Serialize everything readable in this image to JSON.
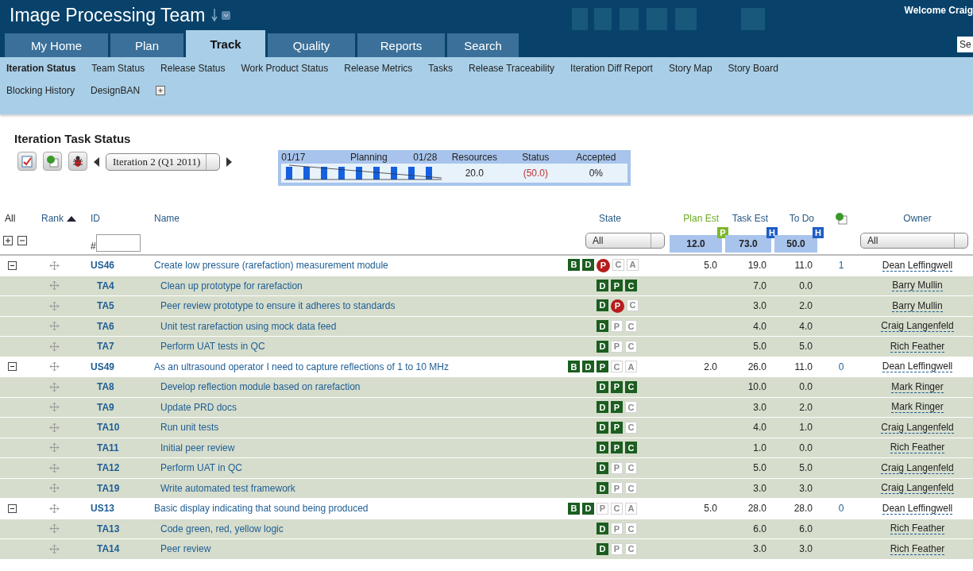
{
  "header": {
    "title": "Image Processing Team",
    "welcome": "Welcome Craig",
    "search": {
      "placeholder": "Se"
    }
  },
  "tabs": [
    {
      "label": "My Home",
      "selected": false
    },
    {
      "label": "Plan",
      "selected": false
    },
    {
      "label": "Track",
      "selected": true
    },
    {
      "label": "Quality",
      "selected": false
    },
    {
      "label": "Reports",
      "selected": false
    },
    {
      "label": "Search",
      "selected": false
    }
  ],
  "subnav": [
    {
      "label": "Iteration Status",
      "selected": true
    },
    {
      "label": "Team Status",
      "selected": false
    },
    {
      "label": "Release Status",
      "selected": false
    },
    {
      "label": "Work Product Status",
      "selected": false
    },
    {
      "label": "Release Metrics",
      "selected": false
    },
    {
      "label": "Tasks",
      "selected": false
    },
    {
      "label": "Release Traceability",
      "selected": false
    },
    {
      "label": "Iteration Diff Report",
      "selected": false
    },
    {
      "label": "Story Map",
      "selected": false
    },
    {
      "label": "Story Board",
      "selected": false
    },
    {
      "label": "Blocking History",
      "selected": false
    },
    {
      "label": "DesignBAN",
      "selected": false
    }
  ],
  "page_title": "Iteration Task Status",
  "iteration_select": "Iteration 2 (Q1 2011)",
  "summary": {
    "start": "01/17",
    "phase": "Planning",
    "end": "01/28",
    "resources_label": "Resources",
    "status_label": "Status",
    "accepted_label": "Accepted",
    "resources": "20.0",
    "status": "(50.0)",
    "accepted": "0%"
  },
  "columns": {
    "all": "All",
    "rank": "Rank",
    "id": "ID",
    "name": "Name",
    "state": "State",
    "plan_est": "Plan Est",
    "task_est": "Task Est",
    "todo": "To Do",
    "owner": "Owner"
  },
  "filters": {
    "id_prefix": "#",
    "state": "All",
    "plan_total": "12.0",
    "plan_badge": "P",
    "task_total": "73.0",
    "task_badge": "H",
    "todo_total": "50.0",
    "todo_badge": "H",
    "owner": "All"
  },
  "rows": [
    {
      "kind": "story",
      "expanded": true,
      "id": "US46",
      "name": "Create low pressure (rarefaction) measurement module",
      "states": [
        {
          "letter": "B",
          "done": true,
          "blocked": false
        },
        {
          "letter": "D",
          "done": true,
          "blocked": false
        },
        {
          "letter": "P",
          "done": false,
          "blocked": true
        },
        {
          "letter": "C",
          "done": false,
          "blocked": false
        },
        {
          "letter": "A",
          "done": false,
          "blocked": false
        }
      ],
      "plan_est": "5.0",
      "task_est": "19.0",
      "todo": "11.0",
      "comments": "1",
      "owner": "Dean Leffingwell",
      "children": [
        {
          "kind": "task",
          "id": "TA4",
          "name": "Clean up prototype for rarefaction",
          "states": [
            {
              "letter": "D",
              "done": true,
              "blocked": false
            },
            {
              "letter": "P",
              "done": true,
              "blocked": false
            },
            {
              "letter": "C",
              "done": true,
              "blocked": false
            }
          ],
          "task_est": "7.0",
          "todo": "0.0",
          "owner": "Barry Mullin"
        },
        {
          "kind": "task",
          "id": "TA5",
          "name": "Peer review prototype to ensure it adheres to standards",
          "states": [
            {
              "letter": "D",
              "done": true,
              "blocked": false
            },
            {
              "letter": "P",
              "done": false,
              "blocked": true
            },
            {
              "letter": "C",
              "done": false,
              "blocked": false
            }
          ],
          "task_est": "3.0",
          "todo": "2.0",
          "owner": "Barry Mullin"
        },
        {
          "kind": "task",
          "id": "TA6",
          "name": "Unit test rarefaction using mock data feed",
          "states": [
            {
              "letter": "D",
              "done": true,
              "blocked": false
            },
            {
              "letter": "P",
              "done": false,
              "blocked": false
            },
            {
              "letter": "C",
              "done": false,
              "blocked": false
            }
          ],
          "task_est": "4.0",
          "todo": "4.0",
          "owner": "Craig Langenfeld"
        },
        {
          "kind": "task",
          "id": "TA7",
          "name": "Perform UAT tests in QC",
          "states": [
            {
              "letter": "D",
              "done": true,
              "blocked": false
            },
            {
              "letter": "P",
              "done": false,
              "blocked": false
            },
            {
              "letter": "C",
              "done": false,
              "blocked": false
            }
          ],
          "task_est": "5.0",
          "todo": "5.0",
          "owner": "Rich Feather"
        }
      ]
    },
    {
      "kind": "story",
      "expanded": true,
      "id": "US49",
      "name": "As an ultrasound operator I need to capture reflections of 1 to 10 MHz",
      "states": [
        {
          "letter": "B",
          "done": true,
          "blocked": false
        },
        {
          "letter": "D",
          "done": true,
          "blocked": false
        },
        {
          "letter": "P",
          "done": true,
          "blocked": false
        },
        {
          "letter": "C",
          "done": false,
          "blocked": false
        },
        {
          "letter": "A",
          "done": false,
          "blocked": false
        }
      ],
      "plan_est": "2.0",
      "task_est": "26.0",
      "todo": "11.0",
      "comments": "0",
      "owner": "Dean Leffingwell",
      "children": [
        {
          "kind": "task",
          "id": "TA8",
          "name": "Develop reflection module based on rarefaction",
          "states": [
            {
              "letter": "D",
              "done": true,
              "blocked": false
            },
            {
              "letter": "P",
              "done": true,
              "blocked": false
            },
            {
              "letter": "C",
              "done": true,
              "blocked": false
            }
          ],
          "task_est": "10.0",
          "todo": "0.0",
          "owner": "Mark Ringer"
        },
        {
          "kind": "task",
          "id": "TA9",
          "name": "Update PRD docs",
          "states": [
            {
              "letter": "D",
              "done": true,
              "blocked": false
            },
            {
              "letter": "P",
              "done": true,
              "blocked": false
            },
            {
              "letter": "C",
              "done": false,
              "blocked": false
            }
          ],
          "task_est": "3.0",
          "todo": "2.0",
          "owner": "Mark Ringer"
        },
        {
          "kind": "task",
          "id": "TA10",
          "name": "Run unit tests",
          "states": [
            {
              "letter": "D",
              "done": true,
              "blocked": false
            },
            {
              "letter": "P",
              "done": true,
              "blocked": false
            },
            {
              "letter": "C",
              "done": false,
              "blocked": false
            }
          ],
          "task_est": "4.0",
          "todo": "1.0",
          "owner": "Craig Langenfeld"
        },
        {
          "kind": "task",
          "id": "TA11",
          "name": "Initial peer review",
          "states": [
            {
              "letter": "D",
              "done": true,
              "blocked": false
            },
            {
              "letter": "P",
              "done": true,
              "blocked": false
            },
            {
              "letter": "C",
              "done": true,
              "blocked": false
            }
          ],
          "task_est": "1.0",
          "todo": "0.0",
          "owner": "Rich Feather"
        },
        {
          "kind": "task",
          "id": "TA12",
          "name": "Perform UAT in QC",
          "states": [
            {
              "letter": "D",
              "done": true,
              "blocked": false
            },
            {
              "letter": "P",
              "done": false,
              "blocked": false
            },
            {
              "letter": "C",
              "done": false,
              "blocked": false
            }
          ],
          "task_est": "5.0",
          "todo": "5.0",
          "owner": "Craig Langenfeld"
        },
        {
          "kind": "task",
          "id": "TA19",
          "name": "Write automated test framework",
          "states": [
            {
              "letter": "D",
              "done": true,
              "blocked": false
            },
            {
              "letter": "P",
              "done": false,
              "blocked": false
            },
            {
              "letter": "C",
              "done": false,
              "blocked": false
            }
          ],
          "task_est": "3.0",
          "todo": "3.0",
          "owner": "Craig Langenfeld"
        }
      ]
    },
    {
      "kind": "story",
      "expanded": true,
      "id": "US13",
      "name": "Basic display indicating that sound being produced",
      "states": [
        {
          "letter": "B",
          "done": true,
          "blocked": false
        },
        {
          "letter": "D",
          "done": true,
          "blocked": false
        },
        {
          "letter": "P",
          "done": false,
          "blocked": false
        },
        {
          "letter": "C",
          "done": false,
          "blocked": false
        },
        {
          "letter": "A",
          "done": false,
          "blocked": false
        }
      ],
      "plan_est": "5.0",
      "task_est": "28.0",
      "todo": "28.0",
      "comments": "0",
      "owner": "Dean Leffingwell",
      "children": [
        {
          "kind": "task",
          "id": "TA13",
          "name": "Code green, red, yellow logic",
          "states": [
            {
              "letter": "D",
              "done": true,
              "blocked": false
            },
            {
              "letter": "P",
              "done": false,
              "blocked": false
            },
            {
              "letter": "C",
              "done": false,
              "blocked": false
            }
          ],
          "task_est": "6.0",
          "todo": "6.0",
          "owner": "Rich Feather"
        },
        {
          "kind": "task",
          "id": "TA14",
          "name": "Peer review",
          "states": [
            {
              "letter": "D",
              "done": true,
              "blocked": false
            },
            {
              "letter": "P",
              "done": false,
              "blocked": false
            },
            {
              "letter": "C",
              "done": false,
              "blocked": false
            }
          ],
          "task_est": "3.0",
          "todo": "3.0",
          "owner": "Rich Feather"
        }
      ]
    }
  ]
}
